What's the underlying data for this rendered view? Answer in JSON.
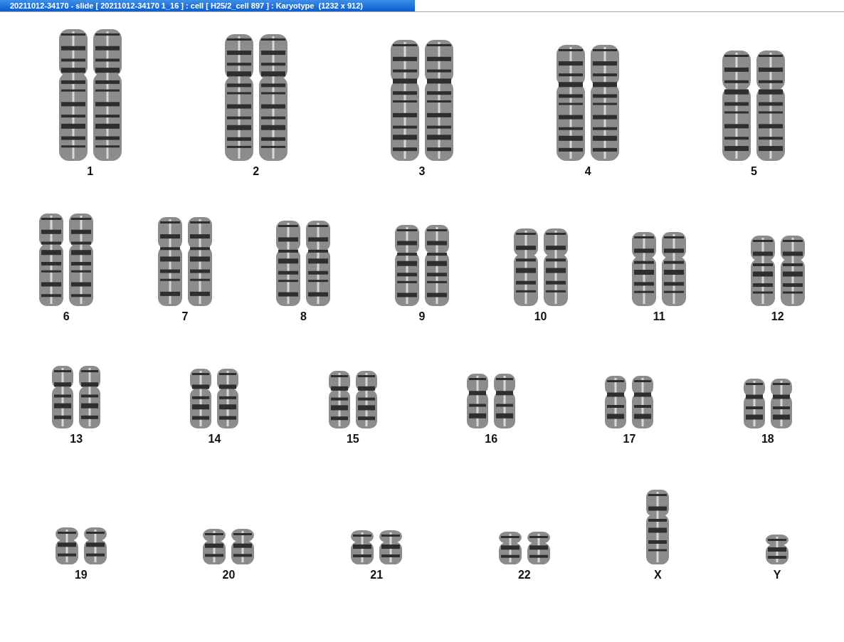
{
  "window": {
    "title": "20211012-34170 - slide [ 20211012-34170 1_16 ] : cell [ H25/2_cell 897 ] : Karyotype  (1232 x 912)"
  },
  "karyotype": {
    "rows": [
      {
        "chromosomes": [
          {
            "label": "1",
            "kind": "pair"
          },
          {
            "label": "2",
            "kind": "pair"
          },
          {
            "label": "3",
            "kind": "pair"
          },
          {
            "label": "4",
            "kind": "pair"
          },
          {
            "label": "5",
            "kind": "pair"
          }
        ]
      },
      {
        "chromosomes": [
          {
            "label": "6",
            "kind": "pair"
          },
          {
            "label": "7",
            "kind": "pair"
          },
          {
            "label": "8",
            "kind": "pair"
          },
          {
            "label": "9",
            "kind": "pair"
          },
          {
            "label": "10",
            "kind": "pair"
          },
          {
            "label": "11",
            "kind": "pair"
          },
          {
            "label": "12",
            "kind": "pair"
          }
        ]
      },
      {
        "chromosomes": [
          {
            "label": "13",
            "kind": "pair"
          },
          {
            "label": "14",
            "kind": "pair"
          },
          {
            "label": "15",
            "kind": "pair"
          },
          {
            "label": "16",
            "kind": "pair"
          },
          {
            "label": "17",
            "kind": "pair"
          },
          {
            "label": "18",
            "kind": "pair"
          }
        ]
      },
      {
        "chromosomes": [
          {
            "label": "19",
            "kind": "pair"
          },
          {
            "label": "20",
            "kind": "pair"
          },
          {
            "label": "21",
            "kind": "pair"
          },
          {
            "label": "22",
            "kind": "pair"
          },
          {
            "label": "X",
            "kind": "single"
          },
          {
            "label": "Y",
            "kind": "single"
          }
        ]
      }
    ]
  }
}
